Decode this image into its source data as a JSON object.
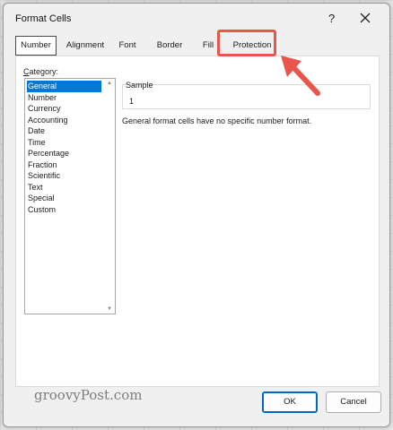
{
  "dialog": {
    "title": "Format Cells",
    "help": "?"
  },
  "tabs": [
    {
      "label": "Number"
    },
    {
      "label": "Alignment"
    },
    {
      "label": "Font"
    },
    {
      "label": "Border"
    },
    {
      "label": "Fill"
    },
    {
      "label": "Protection"
    }
  ],
  "category": {
    "label_prefix": "C",
    "label_rest": "ategory:",
    "items": [
      "General",
      "Number",
      "Currency",
      "Accounting",
      "Date",
      "Time",
      "Percentage",
      "Fraction",
      "Scientific",
      "Text",
      "Special",
      "Custom"
    ],
    "selected": "General"
  },
  "sample": {
    "label": "Sample",
    "value": "1"
  },
  "description": "General format cells have no specific number format.",
  "buttons": {
    "ok": "OK",
    "cancel": "Cancel"
  },
  "watermark": "groovyPost.com",
  "colors": {
    "accent": "#0078d7",
    "annotation": "#e8554a"
  },
  "icons": [
    "close-icon",
    "scroll-up-icon",
    "scroll-down-icon",
    "annotation-arrow-icon"
  ]
}
